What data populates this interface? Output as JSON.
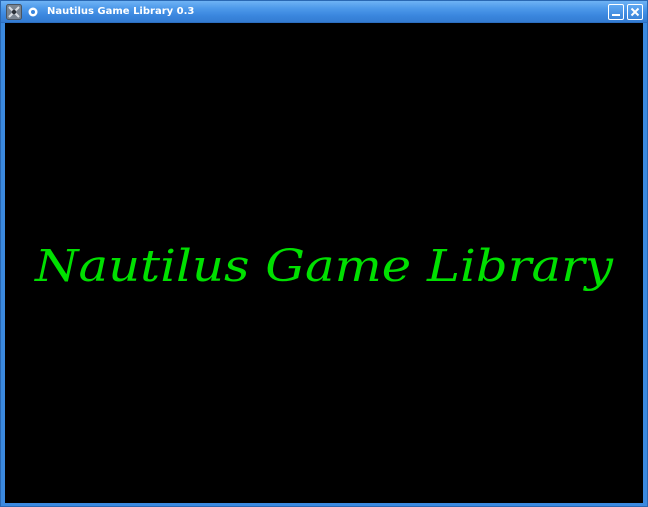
{
  "window": {
    "title": "Nautilus Game Library 0.3"
  },
  "titlebar": {
    "app_icon": "app-icon",
    "menu_icon": "window-menu-icon",
    "minimize_icon": "minimize-icon",
    "close_icon": "close-icon"
  },
  "splash": {
    "text": "Nautilus Game Library",
    "text_color": "#00e000",
    "background": "#000000"
  },
  "colors": {
    "titlebar": "#3a86de",
    "border": "#2a68b3"
  }
}
